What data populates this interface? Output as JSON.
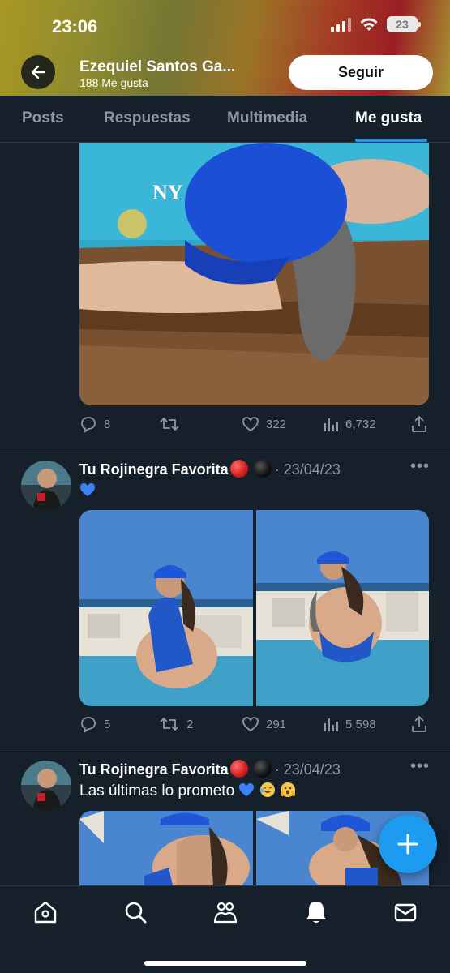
{
  "status_bar": {
    "time": "23:06",
    "battery": "23"
  },
  "header": {
    "name": "Ezequiel Santos Ga...",
    "likes": "188 Me gusta",
    "follow_label": "Seguir"
  },
  "tabs": [
    {
      "label": "Posts",
      "active": false
    },
    {
      "label": "Respuestas",
      "active": false
    },
    {
      "label": "Multimedia",
      "active": false
    },
    {
      "label": "Me gusta",
      "active": true
    }
  ],
  "posts": [
    {
      "stats": {
        "replies": "8",
        "reposts": "",
        "likes": "322",
        "views": "6,732"
      }
    },
    {
      "author": "Tu Rojinegra Favorita",
      "date": "· 23/04/23",
      "text": "",
      "stats": {
        "replies": "5",
        "reposts": "2",
        "likes": "291",
        "views": "5,598"
      }
    },
    {
      "author": "Tu Rojinegra Favorita",
      "date": "· 23/04/23",
      "text": "Las últimas lo prometo"
    }
  ],
  "bottom_nav": [
    "home-icon",
    "search-icon",
    "communities-icon",
    "notifications-icon",
    "messages-icon"
  ],
  "colors": {
    "accent": "#1d9bf0",
    "background": "#15202b",
    "muted": "#8b98a5"
  }
}
